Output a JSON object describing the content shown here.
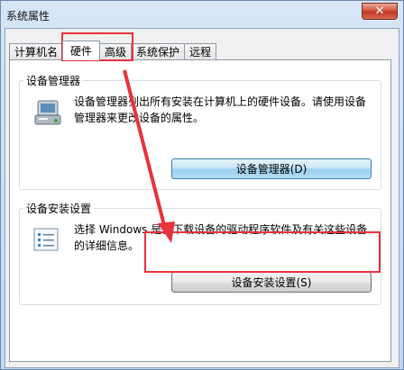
{
  "window": {
    "title": "系统属性",
    "close_glyph": "✕"
  },
  "tabs": [
    {
      "label": "计算机名"
    },
    {
      "label": "硬件",
      "active": true
    },
    {
      "label": "高级"
    },
    {
      "label": "系统保护"
    },
    {
      "label": "远程"
    }
  ],
  "device_manager": {
    "title": "设备管理器",
    "description": "设备管理器列出所有安装在计算机上的硬件设备。请使用设备管理器来更改设备的属性。",
    "button_label": "设备管理器(D)",
    "icon": "device-manager-icon"
  },
  "device_install": {
    "title": "设备安装设置",
    "description": "选择 Windows 是否下载设备的驱动程序软件及有关这些设备的详细信息。",
    "button_label": "设备安装设置(S)",
    "icon": "checklist-icon"
  },
  "annotation_color": "#e8323c"
}
